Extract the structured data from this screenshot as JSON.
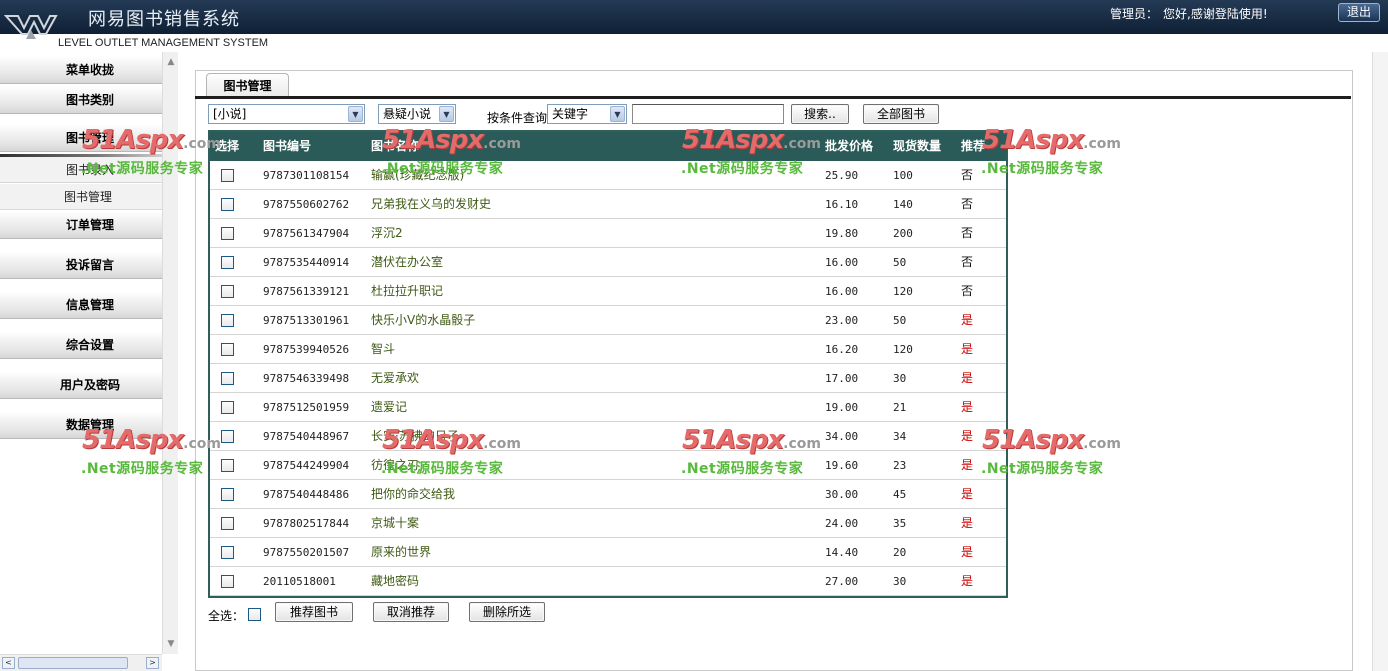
{
  "header": {
    "title": "网易图书销售系统",
    "subtitle": "LEVEL OUTLET MANAGEMENT SYSTEM",
    "admin_label": "管理员：",
    "welcome": "您好,感谢登陆使用!",
    "logout": "退出"
  },
  "sidebar": {
    "items": [
      {
        "label": "菜单收拢"
      },
      {
        "label": "图书类别"
      },
      {
        "label": "图书管理"
      },
      {
        "label": "订单管理"
      },
      {
        "label": "投诉留言"
      },
      {
        "label": "信息管理"
      },
      {
        "label": "综合设置"
      },
      {
        "label": "用户及密码"
      },
      {
        "label": "数据管理"
      }
    ],
    "sub_items": [
      {
        "label": "图书录入"
      },
      {
        "label": "图书管理"
      }
    ],
    "scroll_arrow_left": "<",
    "scroll_arrow_right": ">"
  },
  "main": {
    "tab_label": "图书管理",
    "filters": {
      "category_selected": "[小说]",
      "subcategory_selected": "悬疑小说",
      "search_label": "按条件查询",
      "field_selected": "关键字",
      "keyword_value": "",
      "search_button": "搜索..",
      "all_button": "全部图书"
    },
    "table": {
      "columns": [
        "选择",
        "图书编号",
        "图书名称",
        "批发价格",
        "现货数量",
        "推荐"
      ],
      "rows": [
        {
          "isbn": "9787301108154",
          "name": "输赢(珍藏纪念版)",
          "price": "25.90",
          "stock": "100",
          "rec": "否"
        },
        {
          "isbn": "9787550602762",
          "name": "兄弟我在义乌的发财史",
          "price": "16.10",
          "stock": "140",
          "rec": "否"
        },
        {
          "isbn": "9787561347904",
          "name": "浮沉2",
          "price": "19.80",
          "stock": "200",
          "rec": "否"
        },
        {
          "isbn": "9787535440914",
          "name": "潜伏在办公室",
          "price": "16.00",
          "stock": "50",
          "rec": "否"
        },
        {
          "isbn": "9787561339121",
          "name": "杜拉拉升职记",
          "price": "16.00",
          "stock": "120",
          "rec": "否"
        },
        {
          "isbn": "9787513301961",
          "name": "快乐小V的水晶骰子",
          "price": "23.00",
          "stock": "50",
          "rec": "是"
        },
        {
          "isbn": "9787539940526",
          "name": "智斗",
          "price": "16.20",
          "stock": "120",
          "rec": "是"
        },
        {
          "isbn": "9787546339498",
          "name": "无爱承欢",
          "price": "17.00",
          "stock": "30",
          "rec": "是"
        },
        {
          "isbn": "9787512501959",
          "name": "遗爱记",
          "price": "19.00",
          "stock": "21",
          "rec": "是"
        },
        {
          "isbn": "9787540448967",
          "name": "长安·苏拂的日子",
          "price": "34.00",
          "stock": "34",
          "rec": "是"
        },
        {
          "isbn": "9787544249904",
          "name": "彷徨之刃",
          "price": "19.60",
          "stock": "23",
          "rec": "是"
        },
        {
          "isbn": "9787540448486",
          "name": "把你的命交给我",
          "price": "30.00",
          "stock": "45",
          "rec": "是"
        },
        {
          "isbn": "9787802517844",
          "name": "京城十案",
          "price": "24.00",
          "stock": "35",
          "rec": "是"
        },
        {
          "isbn": "9787550201507",
          "name": "原来的世界",
          "price": "14.40",
          "stock": "20",
          "rec": "是"
        },
        {
          "isbn": "20110518001",
          "name": "藏地密码",
          "price": "27.00",
          "stock": "30",
          "rec": "是"
        }
      ]
    },
    "bottom": {
      "select_all_label": "全选：",
      "recommend_button": "推荐图书",
      "unrecommend_button": "取消推荐",
      "delete_button": "删除所选"
    }
  },
  "watermark": {
    "logo": "51Aspx",
    "domain": ".com",
    "tagline": ".Net源码服务专家"
  },
  "colors": {
    "header_bg": "#1a2d45",
    "table_header_bg": "#2b5b58",
    "book_name": "#3e5a14",
    "recommended": "#cc0000"
  }
}
